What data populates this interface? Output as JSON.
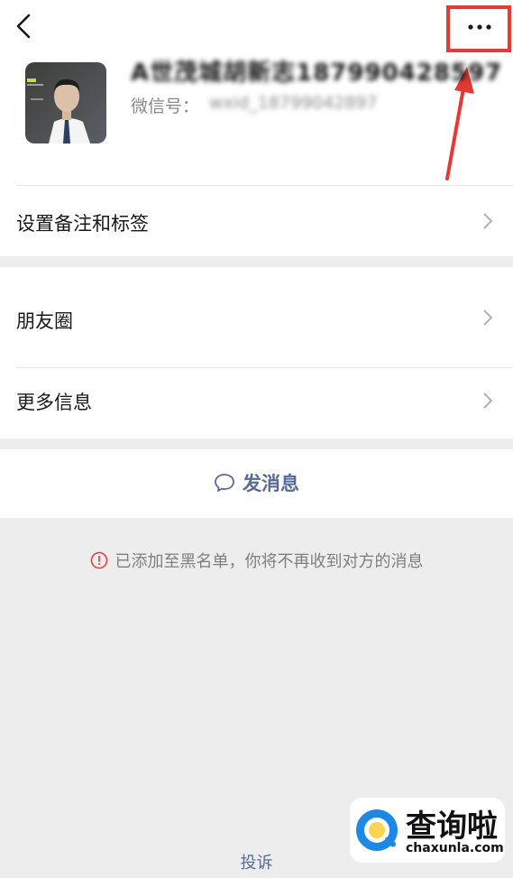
{
  "profile": {
    "name": "A世茂城胡新志187990428597",
    "wechat_id_label": "微信号：",
    "wechat_id_value": "wxid_18799042897"
  },
  "menu": {
    "remark_tags": "设置备注和标签",
    "moments": "朋友圈",
    "more_info": "更多信息"
  },
  "actions": {
    "send_message": "发消息",
    "complain": "投诉"
  },
  "notice": {
    "blacklist": "已添加至黑名单，你将不再收到对方的消息"
  },
  "watermark": {
    "text": "查询啦",
    "url": "chaxunla.com"
  },
  "colors": {
    "link_blue": "#576b95",
    "warning_red": "#e64340",
    "annotation_red": "#e53935",
    "background": "#ededed"
  }
}
